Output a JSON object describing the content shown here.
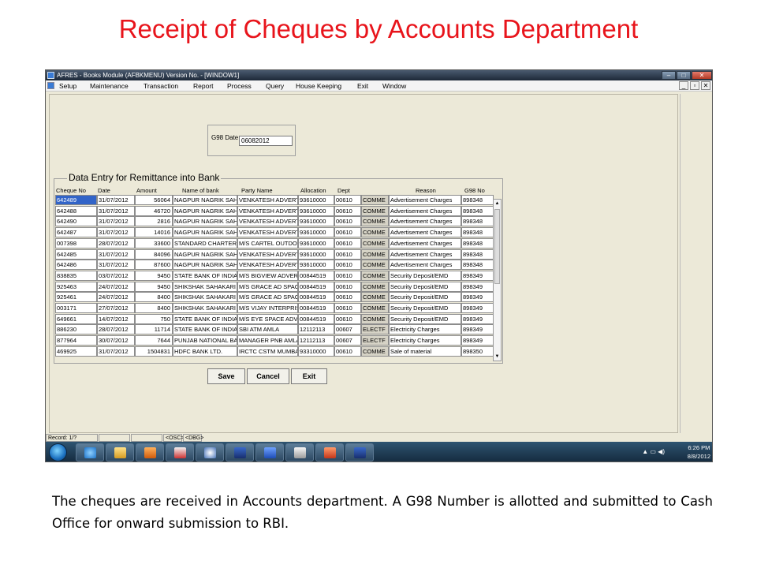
{
  "slide": {
    "title": "Receipt of Cheques by Accounts Department",
    "caption": "The cheques are received in Accounts department. A G98 Number is allotted  and submitted to Cash Office for onward submission to RBI."
  },
  "window": {
    "title": "AFRES - Books Module (AFBKMENU) Version No. - [WINDOW1]",
    "menu": [
      "Setup",
      "Maintenance",
      "Transaction",
      "Report",
      "Process",
      "Query",
      "House Keeping",
      "Exit",
      "Window"
    ]
  },
  "form": {
    "g98_label": "G98 Date",
    "g98_value": "06082012",
    "section_title": "Data Entry for Remittance into Bank",
    "columns": [
      "Cheque No",
      "Date",
      "Amount",
      "Name of bank",
      "Party Name",
      "Allocation",
      "Dept",
      "Reason",
      "G98 No"
    ],
    "rows": [
      [
        "642489",
        "31/07/2012",
        "56064",
        "NAGPUR NAGRIK SAHAK",
        "VENKATESH ADVERTI",
        "93610000",
        "00610",
        "COMME",
        "Advertisement Charges",
        "898348"
      ],
      [
        "642488",
        "31/07/2012",
        "46720",
        "NAGPUR NAGRIK SAHAK",
        "VENKATESH ADVERTI",
        "93610000",
        "00610",
        "COMME",
        "Advertisement Charges",
        "898348"
      ],
      [
        "642490",
        "31/07/2012",
        "2816",
        "NAGPUR NAGRIK SAHAK",
        "VENKATESH ADVERTI",
        "93610000",
        "00610",
        "COMME",
        "Advertisement Charges",
        "898348"
      ],
      [
        "642487",
        "31/07/2012",
        "14016",
        "NAGPUR NAGRIK SAHAK",
        "VENKATESH ADVERTI",
        "93610000",
        "00610",
        "COMME",
        "Advertisement Charges",
        "898348"
      ],
      [
        "007398",
        "28/07/2012",
        "33600",
        "STANDARD CHARTERED",
        "M/S CARTEL OUTDOO",
        "93610000",
        "00610",
        "COMME",
        "Advertisement Charges",
        "898348"
      ],
      [
        "642485",
        "31/07/2012",
        "84096",
        "NAGPUR NAGRIK SAHAK",
        "VENKATESH ADVERTI",
        "93610000",
        "00610",
        "COMME",
        "Advertisement Charges",
        "898348"
      ],
      [
        "642486",
        "31/07/2012",
        "87600",
        "NAGPUR NAGRIK SAHAK",
        "VENKATESH ADVERTI",
        "93610000",
        "00610",
        "COMME",
        "Advertisement Charges",
        "898348"
      ],
      [
        "838835",
        "03/07/2012",
        "9450",
        "STATE BANK OF INDIA",
        "M/S BIGVIEW ADVERT",
        "00844519",
        "00610",
        "COMME",
        "Security Deposit/EMD",
        "898349"
      ],
      [
        "925463",
        "24/07/2012",
        "9450",
        "SHIKSHAK SAHAKARI BA",
        "M/S GRACE AD SPACE",
        "00844519",
        "00610",
        "COMME",
        "Security Deposit/EMD",
        "898349"
      ],
      [
        "925461",
        "24/07/2012",
        "8400",
        "SHIKSHAK SAHAKARI BA",
        "M/S GRACE AD SPACE",
        "00844519",
        "00610",
        "COMME",
        "Security Deposit/EMD",
        "898349"
      ],
      [
        "003171",
        "27/07/2012",
        "8400",
        "SHIKSHAK SAHAKARI BA",
        "M/S VIJAY INTERPRISI",
        "00844519",
        "00610",
        "COMME",
        "Security Deposit/EMD",
        "898349"
      ],
      [
        "649661",
        "14/07/2012",
        "750",
        "STATE BANK OF INDIA",
        "M/S EYE SPACE ADVE",
        "00844519",
        "00610",
        "COMME",
        "Security Deposit/EMD",
        "898349"
      ],
      [
        "886230",
        "28/07/2012",
        "11714",
        "STATE BANK OF INDIA",
        "SBI ATM AMLA",
        "12112113",
        "00607",
        "ELECTF",
        "Electricity Charges",
        "898349"
      ],
      [
        "877964",
        "30/07/2012",
        "7644",
        "PUNJAB NATIONAL BANK",
        "MANAGER PNB AMLA",
        "12112113",
        "00607",
        "ELECTF",
        "Electricity Charges",
        "898349"
      ],
      [
        "469925",
        "31/07/2012",
        "1504831",
        "HDFC BANK LTD.",
        "IRCTC CSTM MUMBAI",
        "93310000",
        "00610",
        "COMME",
        "Sale of material",
        "898350"
      ]
    ],
    "buttons": [
      "Save",
      "Cancel",
      "Exit"
    ]
  },
  "statusbar": {
    "record": "Record: 1/?",
    "osc": "<OSC>",
    "dbg": "<DBG>"
  },
  "taskbar": {
    "time": "6:26 PM",
    "date": "8/8/2012",
    "apps": [
      "ie-icon",
      "explorer-icon",
      "media-player-icon",
      "app-icon",
      "compass-icon",
      "afres-icon",
      "word-icon",
      "calendar-icon",
      "powerpoint-icon",
      "afres-icon-2"
    ]
  }
}
